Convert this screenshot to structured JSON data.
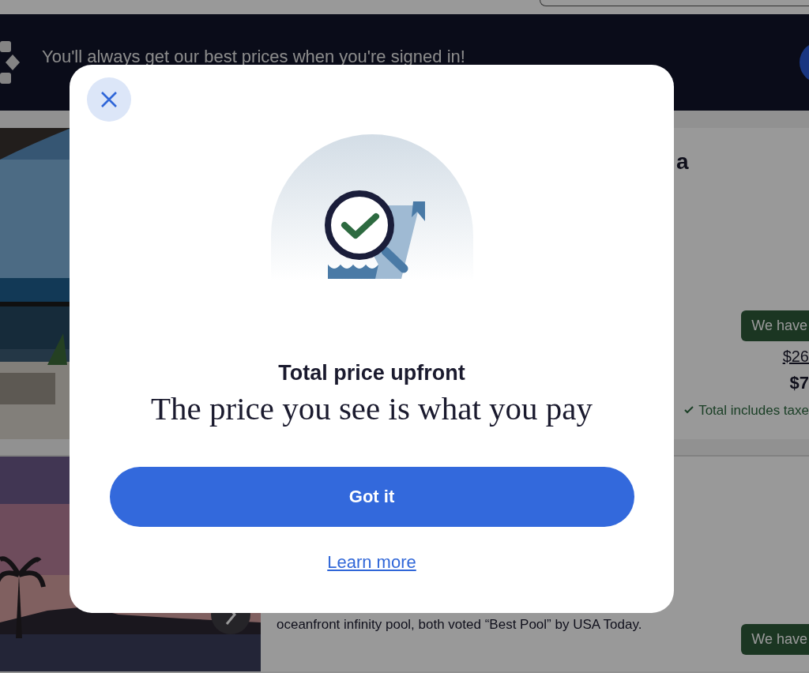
{
  "banner": {
    "message": "You'll always get our best prices when you're signed in!"
  },
  "listings": [
    {
      "title_fragment": "a",
      "badge": "We have",
      "original_price": "$26",
      "price": "$7",
      "price_note": "Total includes taxe"
    },
    {
      "description": "oceanfront infinity pool, both voted “Best Pool” by USA Today.",
      "badge": "We have"
    }
  ],
  "dialog": {
    "title": "Total price upfront",
    "subtitle": "The price you see is what you pay",
    "primary_button": "Got it",
    "link": "Learn more"
  }
}
